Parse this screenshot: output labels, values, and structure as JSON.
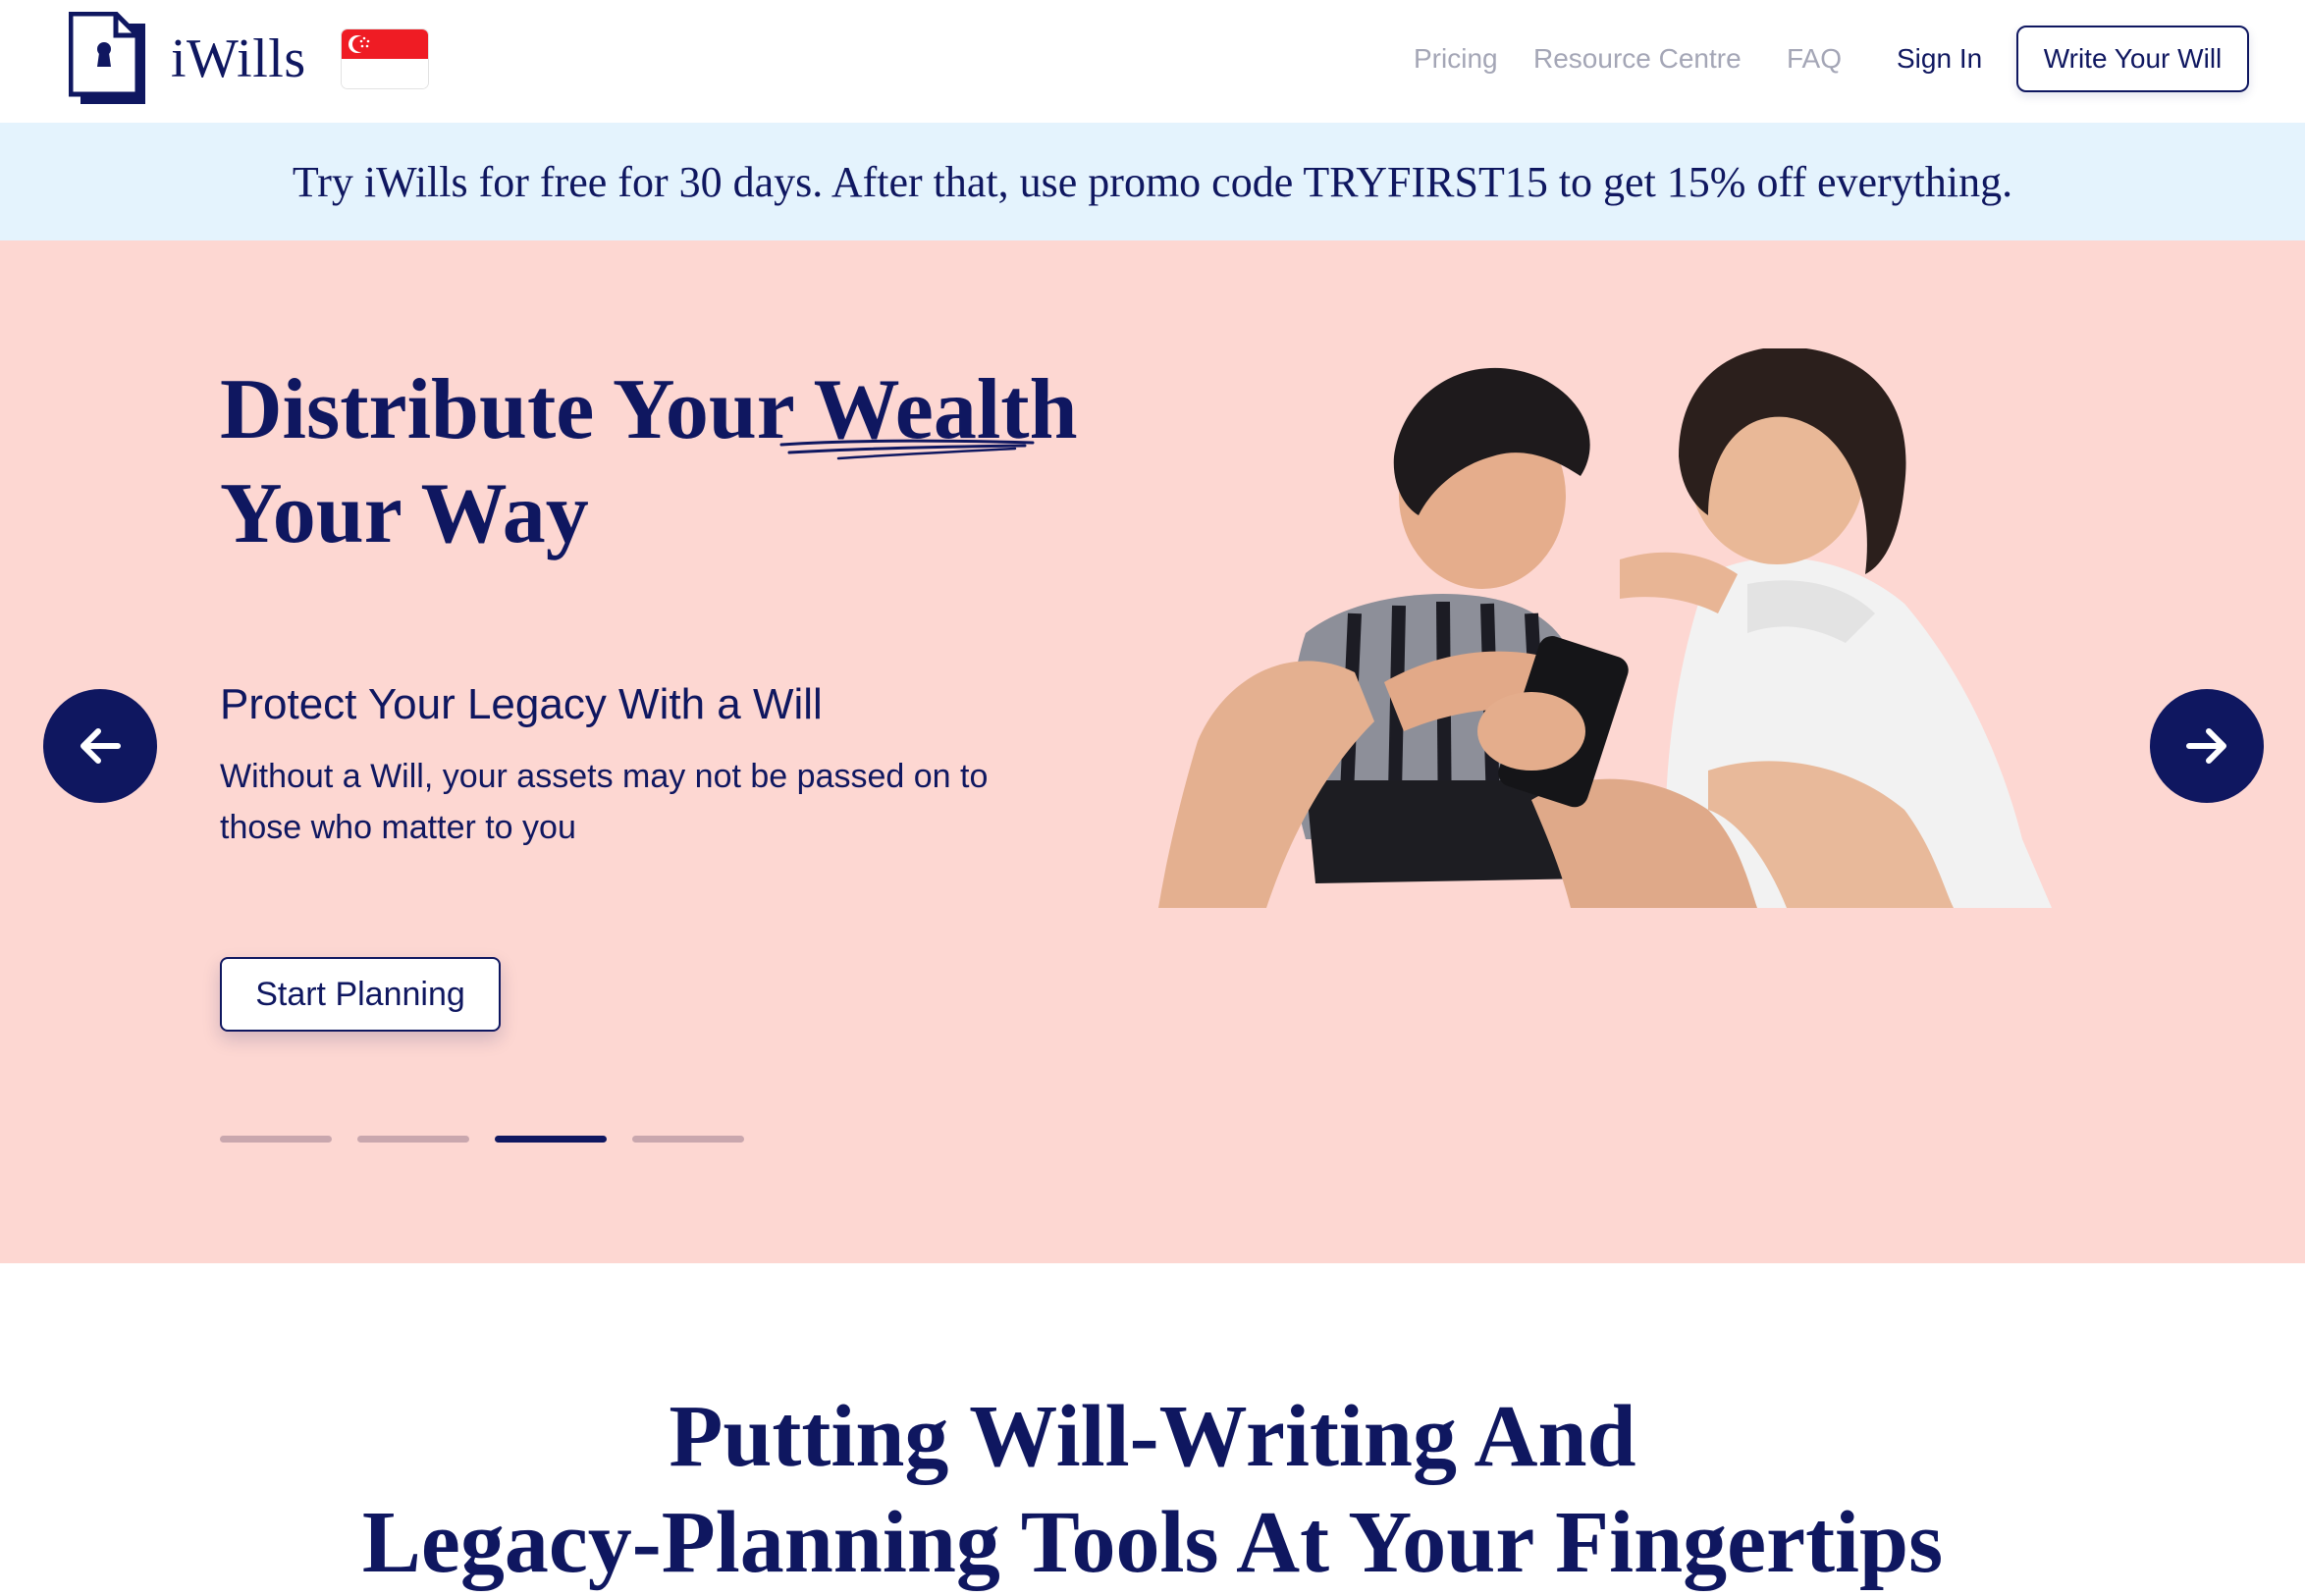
{
  "header": {
    "brand": "iWills",
    "nav": {
      "pricing": "Pricing",
      "resource_centre": "Resource Centre",
      "faq": "FAQ",
      "sign_in": "Sign In"
    },
    "cta": "Write Your Will",
    "flag": "singapore-flag-icon"
  },
  "promo": {
    "text": "Try iWills for free for 30 days. After that, use promo code TRYFIRST15 to get 15% off everything."
  },
  "hero": {
    "title_part1": "Distribute Your ",
    "title_highlight": "Wealth",
    "title_line2": "Your Way",
    "subtitle": "Protect Your Legacy With a Will",
    "description": "Without a Will, your assets may not be passed on to those who matter to you",
    "button": "Start Planning",
    "slides_total": 4,
    "active_slide": 3
  },
  "section": {
    "title_line1": "Putting Will-Writing And",
    "title_line2": "Legacy-Planning Tools At Your Fingertips"
  },
  "colors": {
    "navy": "#0f1760",
    "promo_bg": "#e4f3fd",
    "hero_bg": "#fdd7d2"
  }
}
